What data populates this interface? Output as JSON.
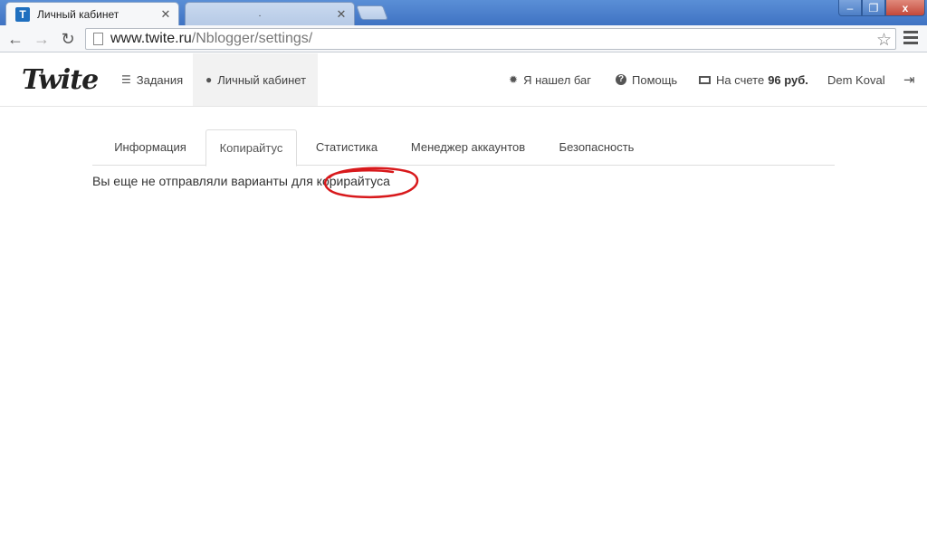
{
  "browser": {
    "active_tab": {
      "title": "Личный кабинет",
      "favicon": "T"
    },
    "inactive_tab": {
      "title": "."
    },
    "window_controls": {
      "minimize": "–",
      "maximize": "❐",
      "close": "x"
    },
    "url_host": "www.twite.ru",
    "url_path": "/Nblogger/settings/",
    "accent_color": "#3f73c3"
  },
  "header": {
    "logo": "Twite",
    "nav": {
      "tasks": "Задания",
      "cabinet": "Личный кабинет",
      "bug": "Я нашел баг",
      "help": "Помощь",
      "balance_prefix": "На счете",
      "balance_amount": "96 руб.",
      "user": "Dem Koval"
    }
  },
  "content": {
    "tabs": [
      "Информация",
      "Копирайтус",
      "Статистика",
      "Менеджер аккаунтов",
      "Безопасность"
    ],
    "active_tab": "Копирайтус",
    "empty_message": "Вы еще не отправляли варианты для корирайтуса",
    "annotation_color": "#d8191c"
  }
}
